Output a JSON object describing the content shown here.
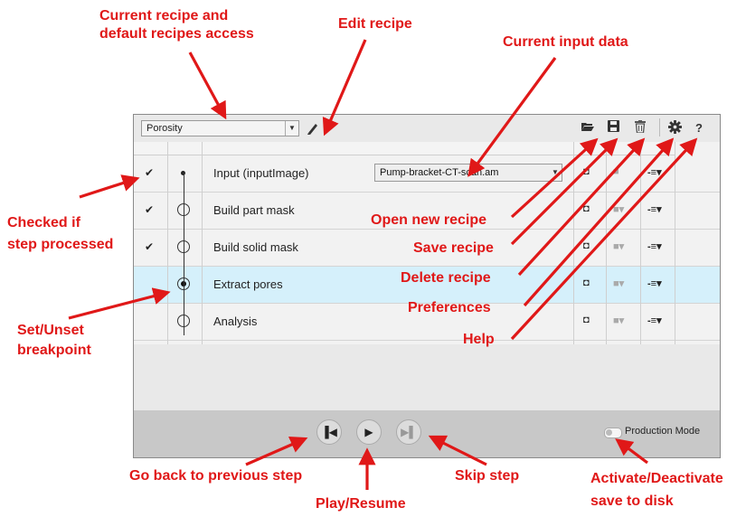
{
  "toolbar": {
    "recipe_value": "Porosity",
    "icons": [
      "folder-open-icon",
      "save-icon",
      "trash-icon",
      "gear-icon",
      "help-icon"
    ],
    "help_glyph": "?"
  },
  "steps": [
    {
      "name": "Input (inputImage)",
      "checked": true,
      "node": "small-dot",
      "input_value": "Pump-bracket-CT-scan.am"
    },
    {
      "name": "Build part mask",
      "checked": true,
      "node": "circle"
    },
    {
      "name": "Build solid mask",
      "checked": true,
      "node": "circle"
    },
    {
      "name": "Extract pores",
      "checked": false,
      "node": "breakpoint",
      "active": true
    },
    {
      "name": "Analysis",
      "checked": false,
      "node": "circle"
    }
  ],
  "check_glyph": "✔",
  "bottom": {
    "production_mode_label": "Production Mode",
    "production_mode_on": false
  },
  "annotations": {
    "recipe_access": "Current recipe and\ndefault recipes access",
    "edit_recipe": "Edit recipe",
    "current_input": "Current input data",
    "checked_if": "Checked if\nstep processed",
    "open_new": "Open new recipe",
    "save_recipe": "Save recipe",
    "delete_recipe": "Delete recipe",
    "preferences": "Preferences",
    "help": "Help",
    "set_unset": "Set/Unset\nbreakpoint",
    "go_back": "Go back to previous step",
    "play_resume": "Play/Resume",
    "skip_step": "Skip step",
    "activate": "Activate/Deactivate\nsave to disk"
  },
  "colors": {
    "annotation": "#e01818",
    "active_row": "#d5f0fb",
    "bottom_bar": "#c8c8c8"
  }
}
